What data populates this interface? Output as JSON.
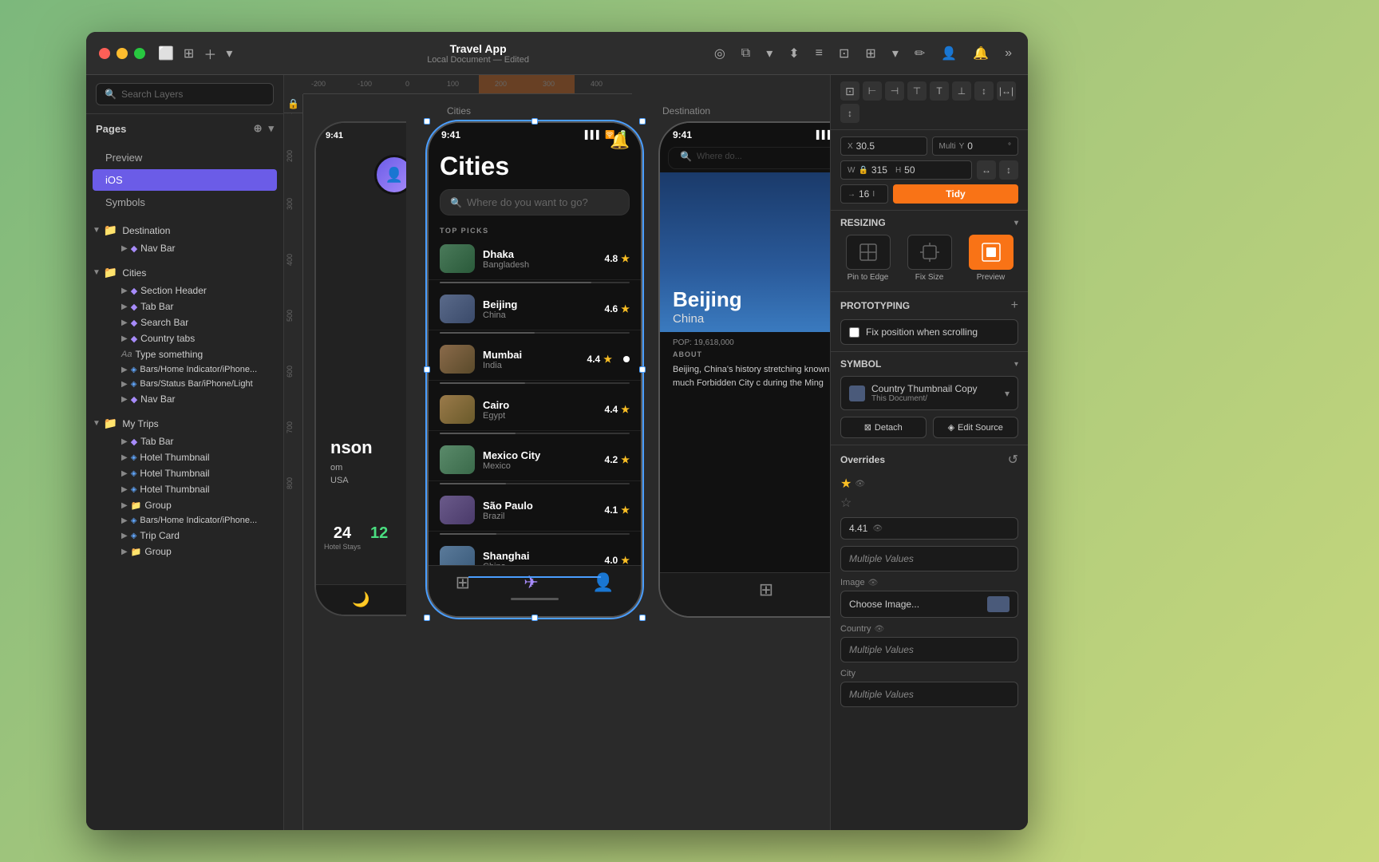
{
  "window": {
    "title": "Travel App",
    "subtitle": "Local Document — Edited"
  },
  "sidebar": {
    "search_placeholder": "Search Layers",
    "pages_label": "Pages",
    "pages": [
      "Preview",
      "iOS",
      "Symbols"
    ],
    "layers": {
      "destination": {
        "label": "Destination",
        "children": [
          "Nav Bar"
        ]
      },
      "cities": {
        "label": "Cities",
        "children": [
          "Section Header",
          "Tab Bar",
          "Search Bar",
          "Country tabs",
          "Type something",
          "Bars/Home Indicator/iPhone...",
          "Bars/Status Bar/iPhone/Light",
          "Nav Bar"
        ]
      },
      "myTrips": {
        "label": "My Trips",
        "children": [
          "Tab Bar",
          "Hotel Thumbnail",
          "Hotel Thumbnail",
          "Hotel Thumbnail",
          "Group",
          "Bars/Home Indicator/iPhone...",
          "Trip Card",
          "Group"
        ]
      }
    }
  },
  "canvas": {
    "frames": [
      "Cities",
      "Destination"
    ],
    "ruler_marks": [
      "-200",
      "-100",
      "0",
      "100",
      "200",
      "300",
      "400",
      "500",
      "600"
    ]
  },
  "cities_phone": {
    "status_time": "9:41",
    "title": "Cities",
    "search_placeholder": "Where do you want to go?",
    "section_label": "TOP PICKS",
    "cities": [
      {
        "name": "Dhaka",
        "country": "Bangladesh",
        "rating": "4.8",
        "thumb_class": "city-thumb-dhaka"
      },
      {
        "name": "Beijing",
        "country": "China",
        "rating": "4.6",
        "thumb_class": "city-thumb-beijing"
      },
      {
        "name": "Mumbai",
        "country": "India",
        "rating": "4.4",
        "thumb_class": "city-thumb-mumbai"
      },
      {
        "name": "Cairo",
        "country": "Egypt",
        "rating": "4.4",
        "thumb_class": "city-thumb-cairo"
      },
      {
        "name": "Mexico City",
        "country": "Mexico",
        "rating": "4.2",
        "thumb_class": "city-thumb-mexico"
      },
      {
        "name": "São Paulo",
        "country": "Brazil",
        "rating": "4.1",
        "thumb_class": "city-thumb-saopaulo"
      },
      {
        "name": "Shanghai",
        "country": "China",
        "rating": "4.0",
        "thumb_class": "city-thumb-shanghai"
      }
    ]
  },
  "destination_phone": {
    "status_time": "9:41",
    "city": "Beijing",
    "country": "China",
    "population": "POP: 19,618,000",
    "about_label": "ABOUT",
    "about_text": "Beijing, China's history stretching known as much Forbidden City c during the Ming"
  },
  "right_panel": {
    "x_label": "X",
    "y_label": "Y",
    "w_label": "W",
    "h_label": "H",
    "x_value": "30.5",
    "y_value": "0",
    "w_value": "315",
    "h_value": "50",
    "y_mode": "Multi",
    "padding": "16",
    "tidy_label": "Tidy",
    "resizing_label": "RESIZING",
    "resize_options": [
      "Pin to Edge",
      "Fix Size",
      "Preview"
    ],
    "prototyping_label": "PROTOTYPING",
    "fix_position_label": "Fix position when scrolling",
    "symbol_label": "SYMBOL",
    "symbol_name": "Country Thumbnail Copy",
    "symbol_path": "This Document/",
    "detach_label": "Detach",
    "edit_source_label": "Edit Source",
    "overrides_label": "Overrides",
    "rating_value": "4.41",
    "multiple_values": "Multiple Values",
    "image_label": "Image",
    "choose_image_label": "Choose Image...",
    "country_label": "Country",
    "city_label": "City"
  }
}
